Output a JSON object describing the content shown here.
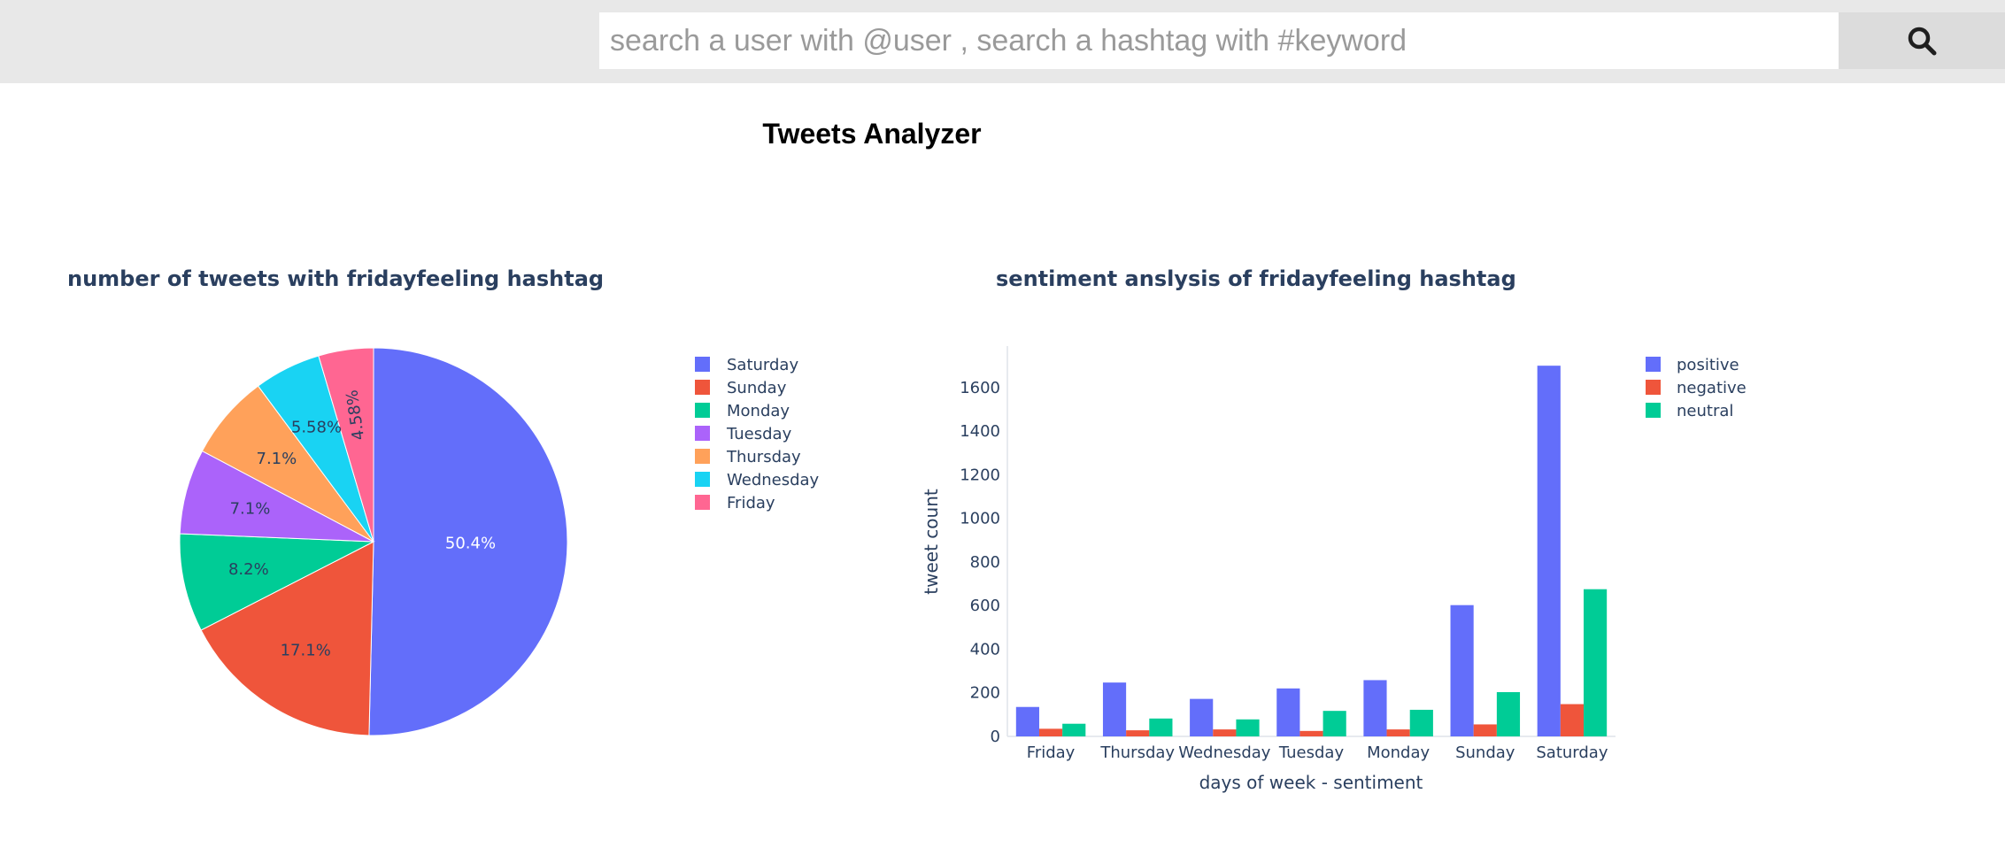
{
  "search": {
    "placeholder": "search a user with @user , search a hashtag with #keyword",
    "button_icon": "search-icon"
  },
  "page": {
    "title": "Tweets Analyzer"
  },
  "colors": {
    "topbar": "#e8e8e8",
    "positive": "#636efa",
    "negative": "#ef553b",
    "neutral": "#00cc96"
  },
  "chart_data": [
    {
      "type": "pie",
      "title": "number of tweets with fridayfeeling hashtag",
      "labels": [
        "Saturday",
        "Sunday",
        "Monday",
        "Tuesday",
        "Thursday",
        "Wednesday",
        "Friday"
      ],
      "values": [
        50.4,
        17.1,
        8.2,
        7.1,
        7.1,
        5.58,
        4.58
      ],
      "value_labels": [
        "50.4%",
        "17.1%",
        "8.2%",
        "7.1%",
        "7.1%",
        "5.58%",
        "4.58%"
      ],
      "colors": [
        "#636efa",
        "#ef553b",
        "#00cc96",
        "#ab63fa",
        "#ffa15a",
        "#19d3f3",
        "#ff6692"
      ],
      "legend": "right",
      "direction": "clockwise",
      "start": "top"
    },
    {
      "type": "bar",
      "title": "sentiment anslysis of fridayfeeling hashtag",
      "xlabel": "days of week - sentiment",
      "ylabel": "tweet count",
      "categories": [
        "Friday",
        "Thursday",
        "Wednesday",
        "Tuesday",
        "Monday",
        "Sunday",
        "Saturday"
      ],
      "series": [
        {
          "name": "positive",
          "color": "#636efa",
          "values": [
            135,
            247,
            172,
            220,
            258,
            602,
            1700
          ]
        },
        {
          "name": "negative",
          "color": "#ef553b",
          "values": [
            35,
            28,
            32,
            25,
            32,
            55,
            148
          ]
        },
        {
          "name": "neutral",
          "color": "#00cc96",
          "values": [
            58,
            82,
            78,
            117,
            122,
            203,
            675
          ]
        }
      ],
      "yticks": [
        0,
        200,
        400,
        600,
        800,
        1000,
        1200,
        1400,
        1600
      ],
      "ylim": [
        0,
        1790
      ],
      "grid": false,
      "legend": "right"
    }
  ]
}
